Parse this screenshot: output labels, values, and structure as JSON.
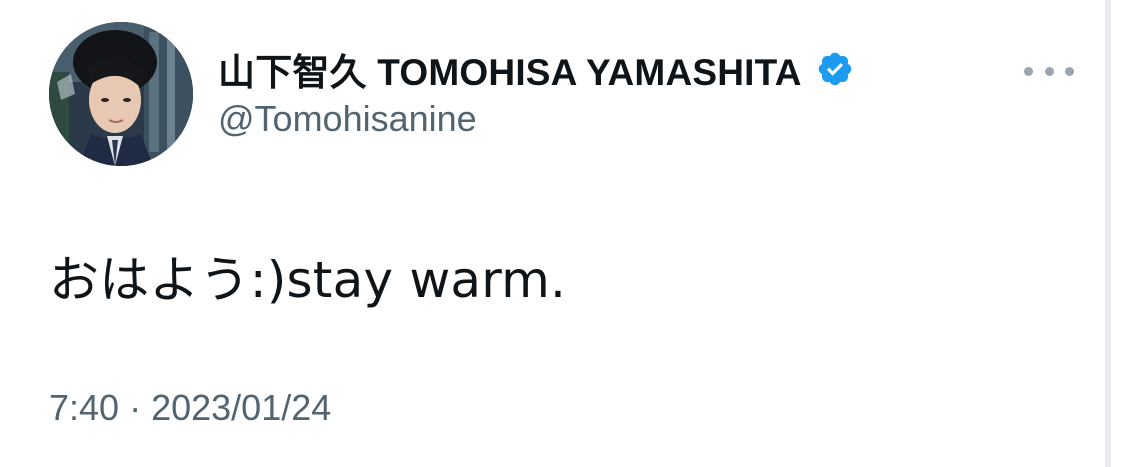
{
  "author": {
    "display_name": "山下智久 TOMOHISA YAMASHITA",
    "handle": "@Tomohisanine",
    "verified_icon": "verified-badge-icon",
    "verified_color": "#1d9bf0"
  },
  "tweet": {
    "text": "おはよう:)stay warm.",
    "time": "7:40",
    "separator": "·",
    "date": "2023/01/24"
  },
  "actions": {
    "more_icon": "more-options-icon"
  },
  "colors": {
    "primary_text": "#0f1419",
    "secondary_text": "#536471",
    "background": "#ffffff"
  }
}
